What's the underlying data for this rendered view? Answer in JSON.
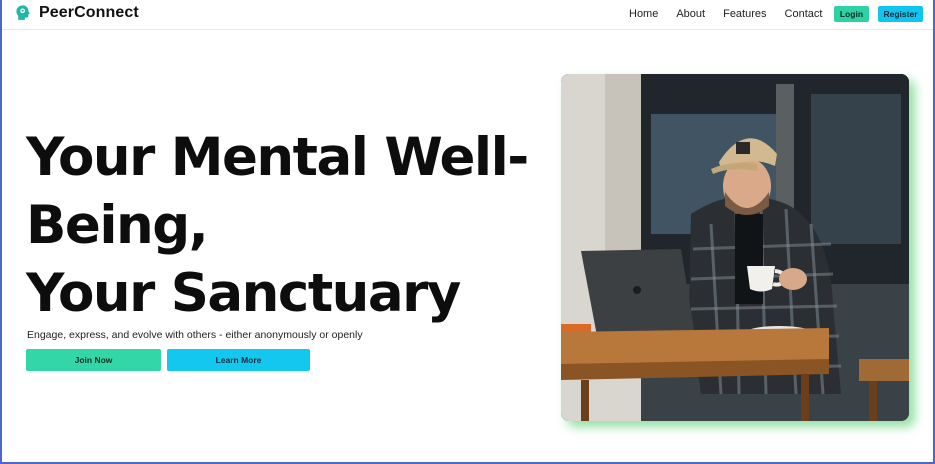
{
  "header": {
    "brand": "PeerConnect",
    "nav": [
      "Home",
      "About",
      "Features",
      "Contact"
    ],
    "login_label": "Login",
    "register_label": "Register"
  },
  "hero": {
    "title_lines": [
      "Your Mental Well-",
      "Being,",
      "Your Sanctuary"
    ],
    "subtitle": "Engage, express, and evolve with others - either anonymously or openly",
    "join_label": "Join Now",
    "learn_label": "Learn More"
  },
  "colors": {
    "primary_green": "#33d6a6",
    "primary_cyan": "#13c7ef"
  },
  "icons": {
    "brand": "head-brain-icon"
  }
}
